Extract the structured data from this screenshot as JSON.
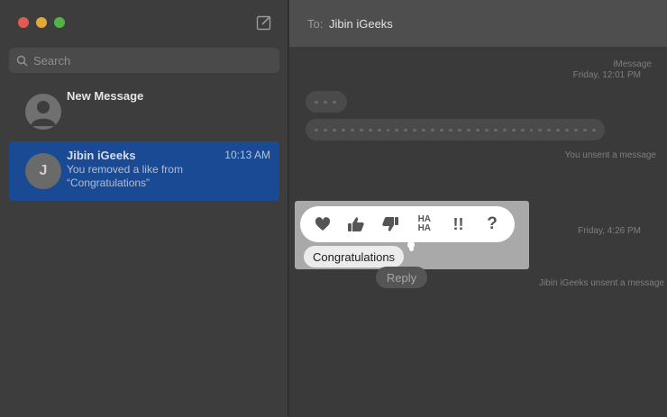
{
  "sidebar": {
    "window_controls": {
      "close_color": "#e05b52",
      "minimize_color": "#e0a93a",
      "zoom_color": "#52b348"
    },
    "compose_icon": "compose-icon",
    "search": {
      "placeholder": "Search",
      "icon": "search-icon"
    },
    "conversations": [
      {
        "title": "New Message"
      },
      {
        "name": "Jibin iGeeks",
        "avatar_letter": "J",
        "time": "10:13 AM",
        "preview": "You removed a like from “Congratulations”"
      }
    ]
  },
  "header": {
    "to_label": "To:",
    "to_name": "Jibin iGeeks"
  },
  "messages": {
    "service": "iMessage",
    "timestamp1": "Friday, 12:01 PM",
    "unsent1": "You unsent a message",
    "timestamp2": "Friday, 4:26 PM",
    "unsent2": "Jibin iGeeks unsent a message"
  },
  "tapback": {
    "options": [
      "heart",
      "thumbs-up",
      "thumbs-down",
      "haha",
      "exclamation",
      "question"
    ],
    "haha_label": "HA\nHA",
    "exclamation_label": "!!",
    "question_label": "?"
  },
  "selected_message": "Congratulations",
  "reply_label": "Reply",
  "colors": {
    "selection_blue": "#1a4a94",
    "overlay_gray": "#a9a9a9"
  }
}
